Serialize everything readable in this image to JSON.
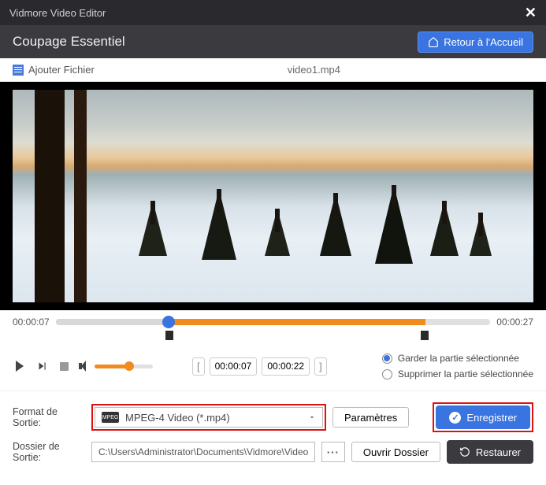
{
  "app": {
    "title": "Vidmore Video Editor"
  },
  "header": {
    "section": "Coupage Essentiel",
    "home": "Retour à l'Accueil"
  },
  "filebar": {
    "add": "Ajouter Fichier",
    "filename": "video1.mp4"
  },
  "timeline": {
    "start": "00:00:07",
    "end": "00:00:27"
  },
  "clip": {
    "in": "00:00:07",
    "out": "00:00:22"
  },
  "keep": {
    "keep_label": "Garder la partie sélectionnée",
    "delete_label": "Supprimer la partie sélectionnée"
  },
  "output": {
    "format_label": "Format de Sortie:",
    "format_value": "MPEG-4 Video (*.mp4)",
    "format_icon_text": "MPEG",
    "settings": "Paramètres",
    "folder_label": "Dossier de Sortie:",
    "folder_path": "C:\\Users\\Administrator\\Documents\\Vidmore\\Video",
    "open_folder": "Ouvrir Dossier"
  },
  "actions": {
    "save": "Enregistrer",
    "restore": "Restaurer"
  }
}
